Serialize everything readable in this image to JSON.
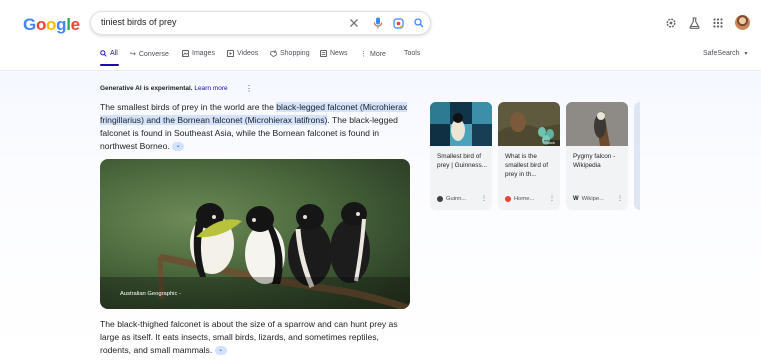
{
  "search": {
    "query": "tiniest birds of prey"
  },
  "tabs": [
    {
      "label": "All",
      "icon": "search-icon",
      "active": true
    },
    {
      "label": "Converse",
      "icon": "converse-icon"
    },
    {
      "label": "Images",
      "icon": "images-icon"
    },
    {
      "label": "Videos",
      "icon": "videos-icon"
    },
    {
      "label": "Shopping",
      "icon": "shopping-icon"
    },
    {
      "label": "News",
      "icon": "news-icon"
    },
    {
      "label": "More",
      "icon": "more-icon"
    },
    {
      "label": "Tools"
    }
  ],
  "safesearch": "SafeSearch",
  "ai": {
    "disclaimer_bold": "Generative AI is experimental.",
    "learn_more": "Learn more",
    "para1_pre": "The smallest birds of prey in the world are the ",
    "para1_hl": "black-legged falconet (Microhierax fringillarius) and the Bornean falconet (Microhierax latifrons)",
    "para1_post": ". The black-legged falconet is found in Southeast Asia, while the Bornean falconet is found in northwest Borneo.",
    "image_credit": "Australian Geographic -",
    "para2": "The black-thighed falconet is about the size of a sparrow and can hunt prey as large as itself. It eats insects, small birds, lizards, and sometimes reptiles, rodents, and small mammals."
  },
  "cards": [
    {
      "title": "Smallest bird of prey | Guinness...",
      "source": "Guinn...",
      "source_color": "#3c4043"
    },
    {
      "title": "What is the smallest bird of prey in th...",
      "source": "Home...",
      "source_color": "#ea4335",
      "image_badge": "iStock"
    },
    {
      "title": "Pygmy falcon - Wikipedia",
      "source": "Wikipe...",
      "source_color": "#202124"
    }
  ],
  "colors": {
    "link": "#1a0dab",
    "highlight": "#d3e3fd",
    "text": "#1f1f1f"
  }
}
